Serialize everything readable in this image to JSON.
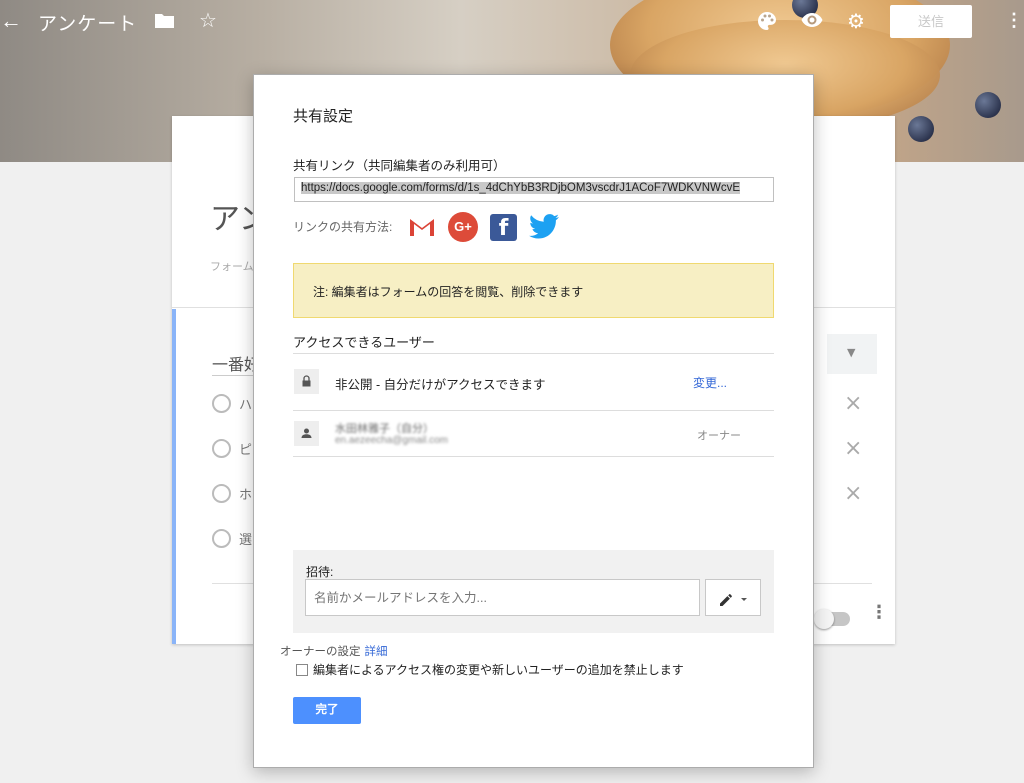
{
  "header": {
    "back_icon": "arrow-left-icon",
    "title": "アンケート",
    "folder_icon": "folder-icon",
    "star_icon": "star-icon",
    "palette_icon": "palette-icon",
    "preview_icon": "eye-icon",
    "settings_icon": "gear-icon",
    "send_label": "送信",
    "more_icon": "more-vert-icon"
  },
  "form": {
    "title_partial": "アン",
    "desc_partial": "フォーム",
    "question_title_partial": "一番好",
    "options": [
      "ハ",
      "ピ",
      "ホ",
      "選"
    ]
  },
  "dialog": {
    "title": "共有設定",
    "link_label": "共有リンク（共同編集者のみ利用可）",
    "link_url": "https://docs.google.com/forms/d/1s_4dChYbB3RDjbOM3vscdrJ1ACoF7WDKVNWcvE",
    "share_label": "リンクの共有方法:",
    "share_icons": [
      "gmail-icon",
      "google-plus-icon",
      "facebook-icon",
      "twitter-icon"
    ],
    "note": "注: 編集者はフォームの回答を閲覧、削除できます",
    "access_label": "アクセスできるユーザー",
    "access_row": {
      "text": "非公開 - 自分だけがアクセスできます",
      "change_link": "変更..."
    },
    "owner": {
      "name": "水田林雅子（自分）",
      "email": "en.aezeecha@gmail.com",
      "role": "オーナー"
    },
    "invite": {
      "label": "招待:",
      "placeholder": "名前かメールアドレスを入力..."
    },
    "owner_settings_label": "オーナーの設定",
    "owner_settings_link": "詳細",
    "checkbox_label": "編集者によるアクセス権の変更や新しいユーザーの追加を禁止します",
    "done_label": "完了"
  },
  "colors": {
    "accent_blue": "#4d90fe",
    "link_blue": "#3367d6",
    "note_bg": "#f7efc4",
    "gplus_red": "#dd4b39",
    "facebook_blue": "#3b5998",
    "twitter_blue": "#1da1f2"
  }
}
